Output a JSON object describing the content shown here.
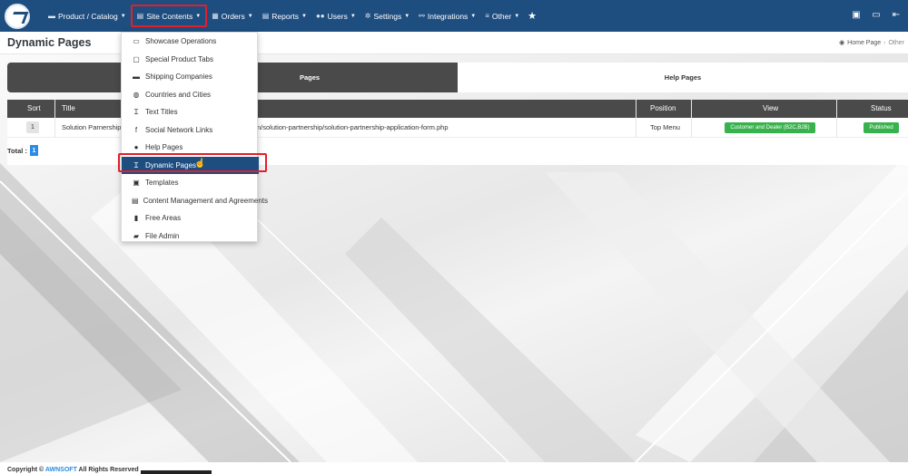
{
  "colors": {
    "navbar": "#1e4d80",
    "accent_red": "#e0202a",
    "success_green": "#38b24d",
    "badge_blue": "#2a8be6"
  },
  "nav": {
    "items": [
      {
        "label": "Product / Catalog",
        "icon": "truck-icon"
      },
      {
        "label": "Site Contents",
        "icon": "pages-icon"
      },
      {
        "label": "Orders",
        "icon": "cart-icon"
      },
      {
        "label": "Reports",
        "icon": "report-icon"
      },
      {
        "label": "Users",
        "icon": "users-icon"
      },
      {
        "label": "Settings",
        "icon": "gears-icon"
      },
      {
        "label": "Integrations",
        "icon": "network-icon"
      },
      {
        "label": "Other",
        "icon": "list-icon"
      }
    ]
  },
  "page": {
    "title": "Dynamic Pages"
  },
  "breadcrumb": {
    "home": "Home Page",
    "current": "Other"
  },
  "tabs": [
    {
      "label": "Dynamic Pages",
      "visible_label": "Pages"
    },
    {
      "label": "Help Pages"
    }
  ],
  "table": {
    "headers": {
      "sort": "Sort",
      "title": "Title",
      "position": "Position",
      "view": "View",
      "status": "Status"
    },
    "rows": [
      {
        "sort": "1",
        "title": "Solution Parnership",
        "url": "com/solution-partnership/solution-partnership-application-form.php",
        "position": "Top Menu",
        "view": "Customer and Dealer (B2C,B2B)",
        "status": "Published"
      }
    ],
    "total_label": "Total :",
    "total_count": "1"
  },
  "dropdown": {
    "items": [
      {
        "label": "Showcase Operations",
        "icon": "monitor-icon"
      },
      {
        "label": "Special Product Tabs",
        "icon": "window-icon"
      },
      {
        "label": "Shipping Companies",
        "icon": "truck-icon"
      },
      {
        "label": "Countries and Cities",
        "icon": "globe-icon"
      },
      {
        "label": "Text Titles",
        "icon": "heading-icon"
      },
      {
        "label": "Social Network Links",
        "icon": "facebook-icon"
      },
      {
        "label": "Help Pages",
        "icon": "info-icon"
      },
      {
        "label": "Dynamic Pages",
        "icon": "heading-icon"
      },
      {
        "label": "Templates",
        "icon": "print-icon"
      },
      {
        "label": "Content Management and Agreements",
        "icon": "document-icon"
      },
      {
        "label": "Free Areas",
        "icon": "file-icon"
      },
      {
        "label": "File Admin",
        "icon": "folder-icon"
      }
    ]
  },
  "footer": {
    "prefix": "Copyright ©",
    "brand": "AWNSOFT",
    "suffix": "All Rights Reserved"
  }
}
